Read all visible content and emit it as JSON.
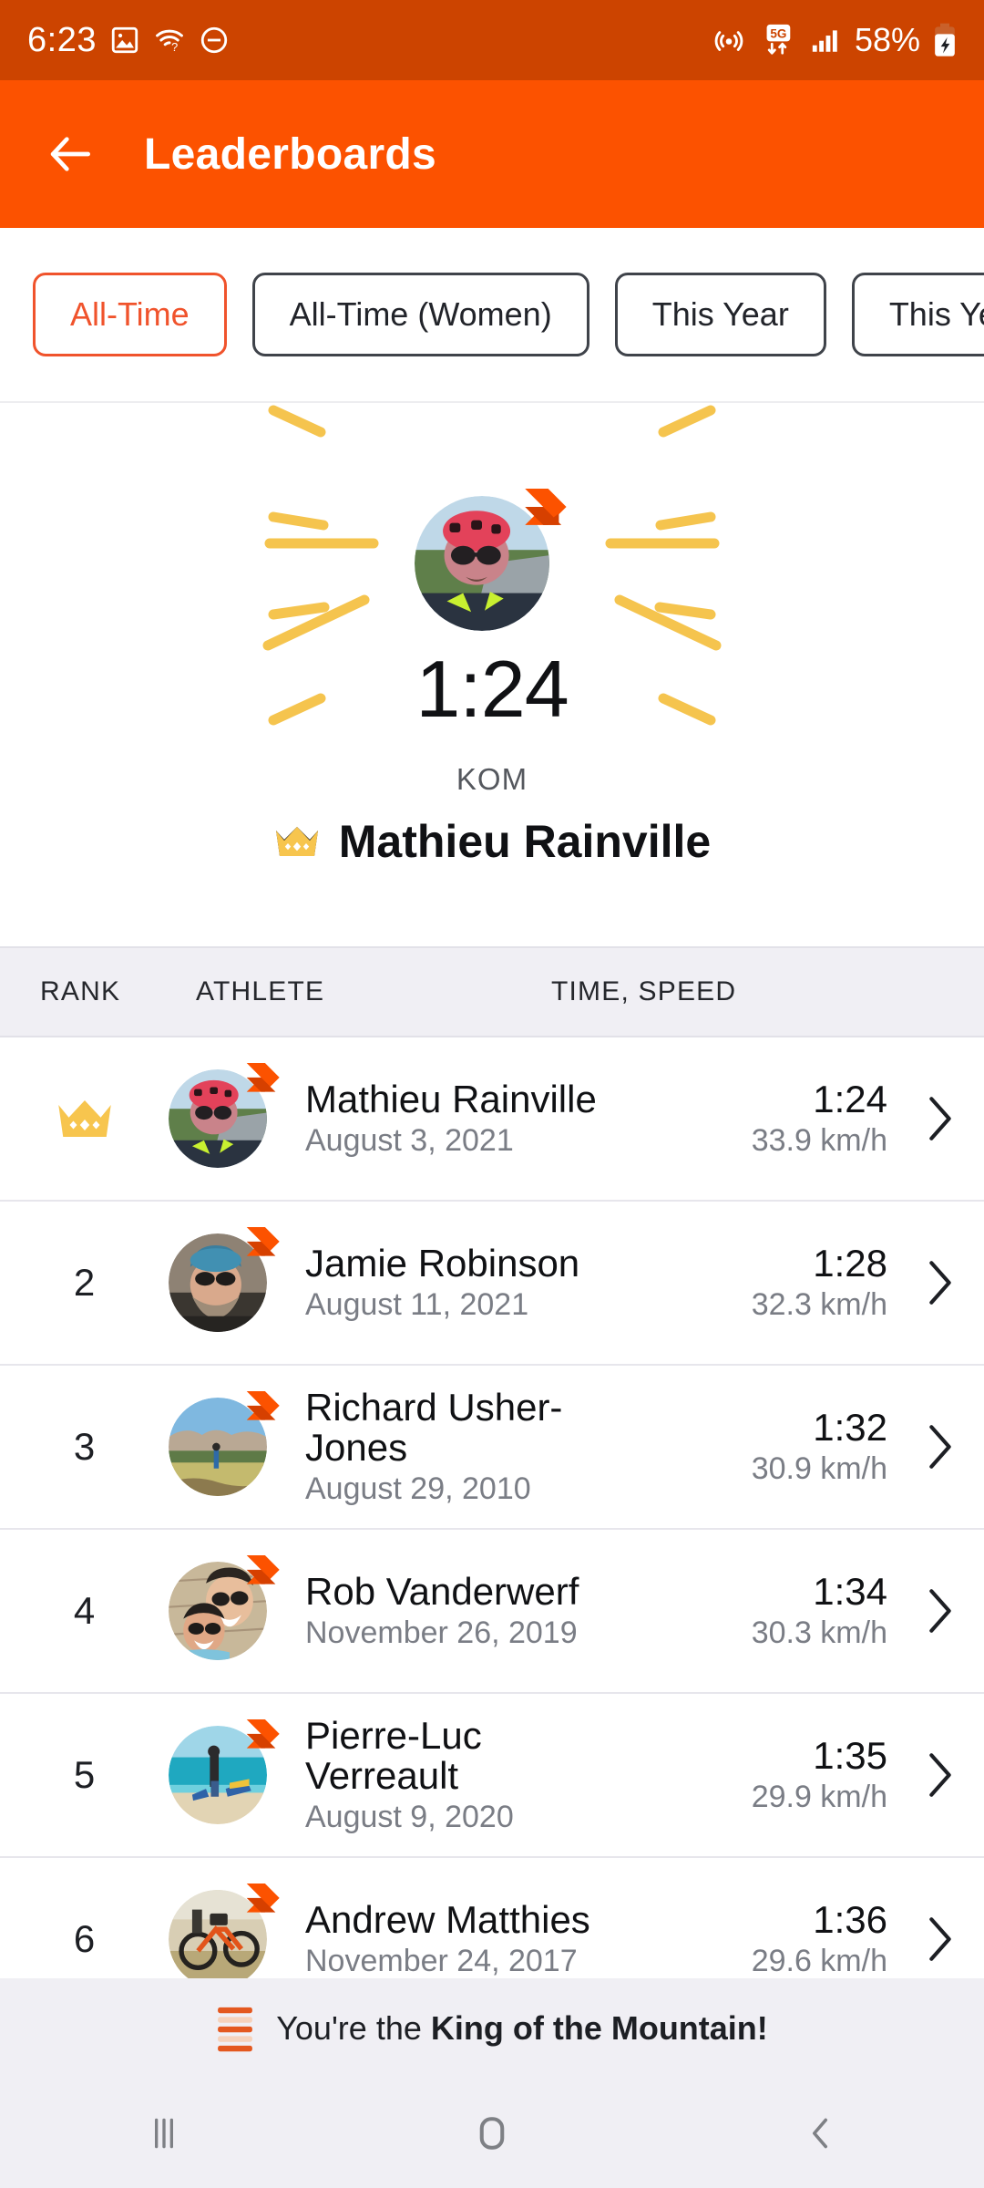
{
  "status_bar": {
    "time": "6:23",
    "battery_percent": "58%",
    "network": "5G",
    "icons": [
      "image-icon",
      "wifi-question-icon",
      "do-not-disturb-icon",
      "hotspot-icon",
      "5g-icon",
      "signal-bars-icon",
      "battery-charging-icon"
    ]
  },
  "app_bar": {
    "title": "Leaderboards",
    "back_icon": "arrow-left-icon",
    "background_color": "#FC5200"
  },
  "filters": {
    "selected": "All-Time",
    "accent_color": "#F0532C",
    "chips": [
      {
        "label": "All-Time",
        "selected": true
      },
      {
        "label": "All-Time (Women)",
        "selected": false
      },
      {
        "label": "This Year",
        "selected": false
      },
      {
        "label": "This Year",
        "selected": false
      }
    ]
  },
  "hero": {
    "time": "1:24",
    "label": "KOM",
    "athlete_name": "Mathieu Rainville",
    "crown_icon": "crown-icon",
    "badge_icon": "strava-chevron-icon",
    "ray_color": "#F5C44E"
  },
  "table": {
    "columns": [
      "RANK",
      "ATHLETE",
      "TIME, SPEED"
    ],
    "rows": [
      {
        "rank": "",
        "rank_icon": "crown-icon",
        "name": "Mathieu Rainville",
        "date": "August 3, 2021",
        "time": "1:24",
        "speed": "33.9 km/h"
      },
      {
        "rank": "2",
        "rank_icon": "",
        "name": "Jamie Robinson",
        "date": "August 11, 2021",
        "time": "1:28",
        "speed": "32.3 km/h"
      },
      {
        "rank": "3",
        "rank_icon": "",
        "name": "Richard Usher-Jones",
        "date": "August 29, 2010",
        "time": "1:32",
        "speed": "30.9 km/h"
      },
      {
        "rank": "4",
        "rank_icon": "",
        "name": "Rob Vanderwerf",
        "date": "November 26, 2019",
        "time": "1:34",
        "speed": "30.3 km/h"
      },
      {
        "rank": "5",
        "rank_icon": "",
        "name": "Pierre-Luc Verreault",
        "date": "August 9, 2020",
        "time": "1:35",
        "speed": "29.9 km/h"
      },
      {
        "rank": "6",
        "rank_icon": "",
        "name": "Andrew Matthies",
        "date": "November 24, 2017",
        "time": "1:36",
        "speed": "29.6 km/h"
      }
    ],
    "chevron_icon": "chevron-right-icon",
    "header_background": "#F0EFF4"
  },
  "banner": {
    "icon": "segment-lines-icon",
    "text_prefix": "You're the ",
    "text_bold": "King of the Mountain!",
    "icon_color": "#E4581F"
  },
  "nav_bar": {
    "recents_icon": "recents-icon",
    "home_icon": "home-icon",
    "back_icon": "back-icon"
  }
}
